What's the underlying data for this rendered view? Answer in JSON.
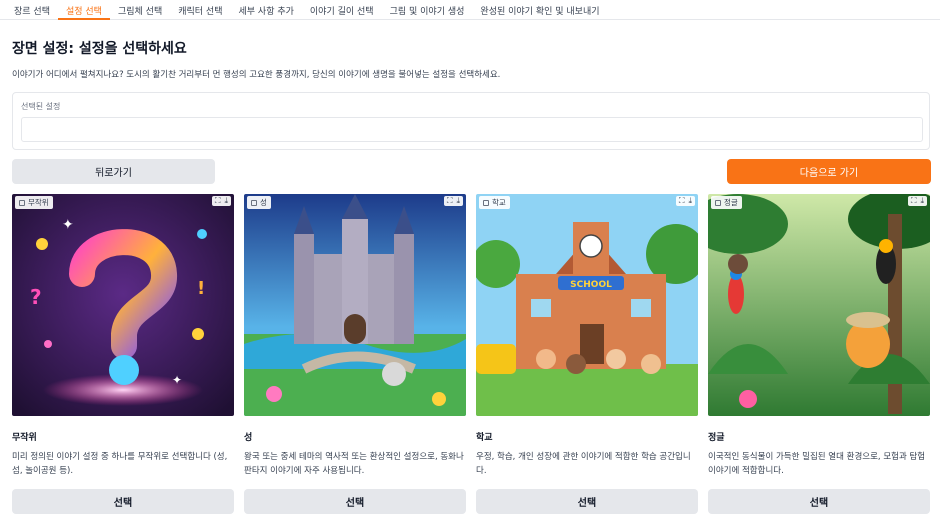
{
  "tabs": [
    {
      "label": "장르 선택"
    },
    {
      "label": "설정 선택"
    },
    {
      "label": "그림체 선택"
    },
    {
      "label": "캐릭터 선택"
    },
    {
      "label": "세부 사항 추가"
    },
    {
      "label": "이야기 길이 선택"
    },
    {
      "label": "그림 및 이야기 생성"
    },
    {
      "label": "완성된 이야기 확인 및 내보내기"
    }
  ],
  "active_tab": 1,
  "page": {
    "title": "장면 설정: 설정을 선택하세요",
    "description": "이야기가 어디에서 펼쳐지나요? 도시의 활기찬 거리부터 먼 행성의 고요한 풍경까지, 당신의 이야기에 생명을 불어넣는 설정을 선택하세요."
  },
  "selected_setting": {
    "label": "선택된 설정",
    "value": ""
  },
  "buttons": {
    "back": "뒤로가기",
    "next": "다음으로 가기"
  },
  "cards": [
    {
      "tag": "무작위",
      "name": "무작위",
      "description": "미리 정의된 이야기 설정 중 하나를 무작위로 선택합니다 (성, 섬, 놀이공원 등).",
      "button": "선택",
      "image_icon": "question-mark-illustration"
    },
    {
      "tag": "성",
      "name": "성",
      "description": "왕국 또는 중세 테마의 역사적 또는 환상적인 설정으로, 동화나 판타지 이야기에 자주 사용됩니다.",
      "button": "선택",
      "image_icon": "castle-illustration"
    },
    {
      "tag": "학교",
      "name": "학교",
      "description": "우정, 학습, 개인 성장에 관한 이야기에 적합한 학습 공간입니다.",
      "button": "선택",
      "image_icon": "school-illustration"
    },
    {
      "tag": "정글",
      "name": "정글",
      "description": "이국적인 동식물이 가득한 밀집된 열대 환경으로, 모험과 탐험 이야기에 적합합니다.",
      "button": "선택",
      "image_icon": "jungle-illustration"
    }
  ],
  "image_tools": {
    "fullscreen_icon": "fullscreen-icon",
    "download_icon": "download-icon"
  },
  "colors": {
    "accent": "#f97316",
    "button_gray": "#e5e7eb"
  }
}
